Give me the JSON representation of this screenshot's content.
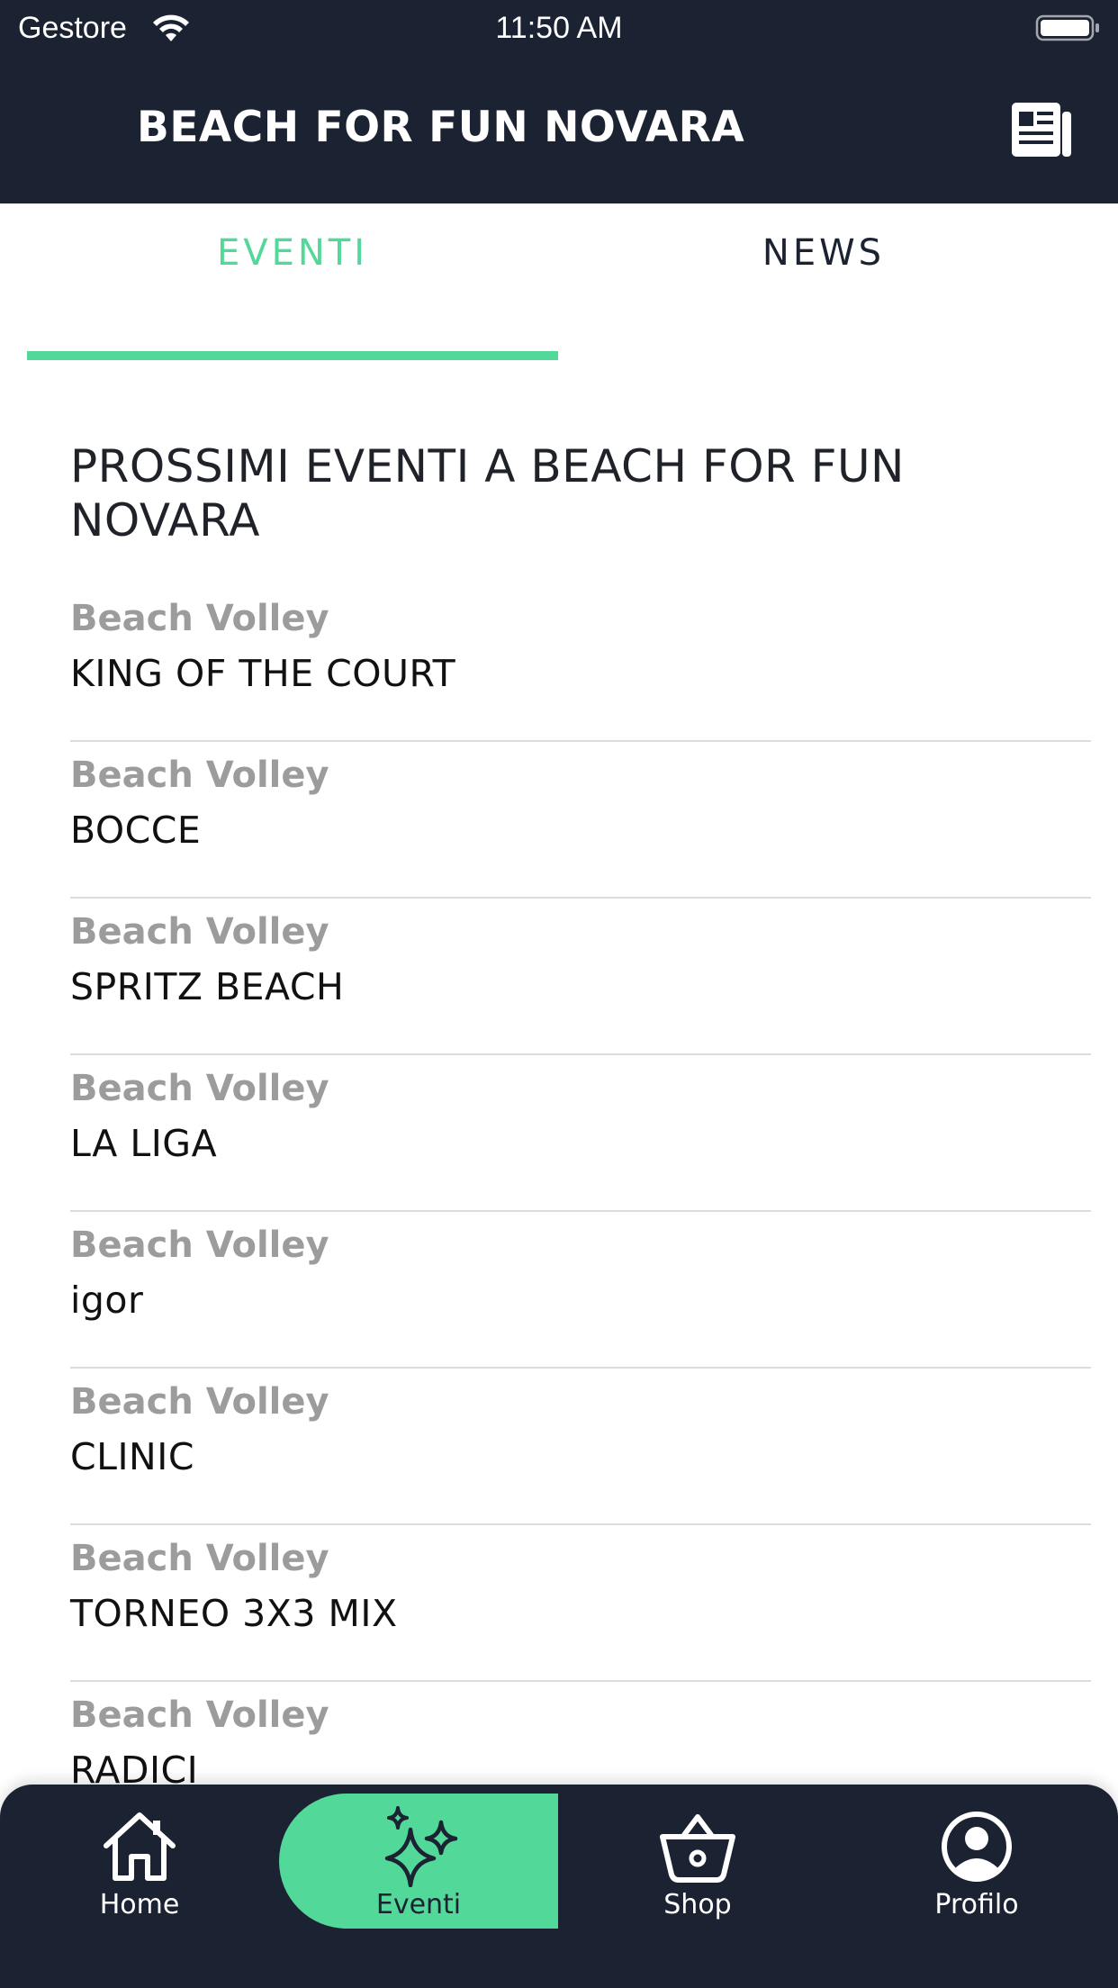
{
  "status_bar": {
    "carrier": "Gestore",
    "time": "11:50 AM"
  },
  "header": {
    "title": "BEACH FOR FUN NOVARA",
    "news_icon": "newspaper-icon"
  },
  "tabs": [
    {
      "label": "EVENTI",
      "active": true
    },
    {
      "label": "NEWS",
      "active": false
    }
  ],
  "section_title": "PROSSIMI EVENTI A BEACH FOR FUN NOVARA",
  "events": [
    {
      "category": "Beach Volley",
      "name": "KING OF THE COURT"
    },
    {
      "category": "Beach Volley",
      "name": "BOCCE"
    },
    {
      "category": "Beach Volley",
      "name": "SPRITZ BEACH"
    },
    {
      "category": "Beach Volley",
      "name": "LA LIGA"
    },
    {
      "category": "Beach Volley",
      "name": "igor"
    },
    {
      "category": "Beach Volley",
      "name": "CLINIC"
    },
    {
      "category": "Beach Volley",
      "name": "TORNEO 3X3 MIX"
    },
    {
      "category": "Beach Volley",
      "name": "RADICI"
    }
  ],
  "tab_bar": [
    {
      "label": "Home",
      "icon": "home-icon",
      "active": false
    },
    {
      "label": "Eventi",
      "icon": "sparkles-icon",
      "active": true
    },
    {
      "label": "Shop",
      "icon": "basket-icon",
      "active": false
    },
    {
      "label": "Profilo",
      "icon": "profile-icon",
      "active": false
    }
  ],
  "colors": {
    "header_bg": "#1b2232",
    "accent": "#52d898",
    "category_text": "#9c9c9c"
  }
}
